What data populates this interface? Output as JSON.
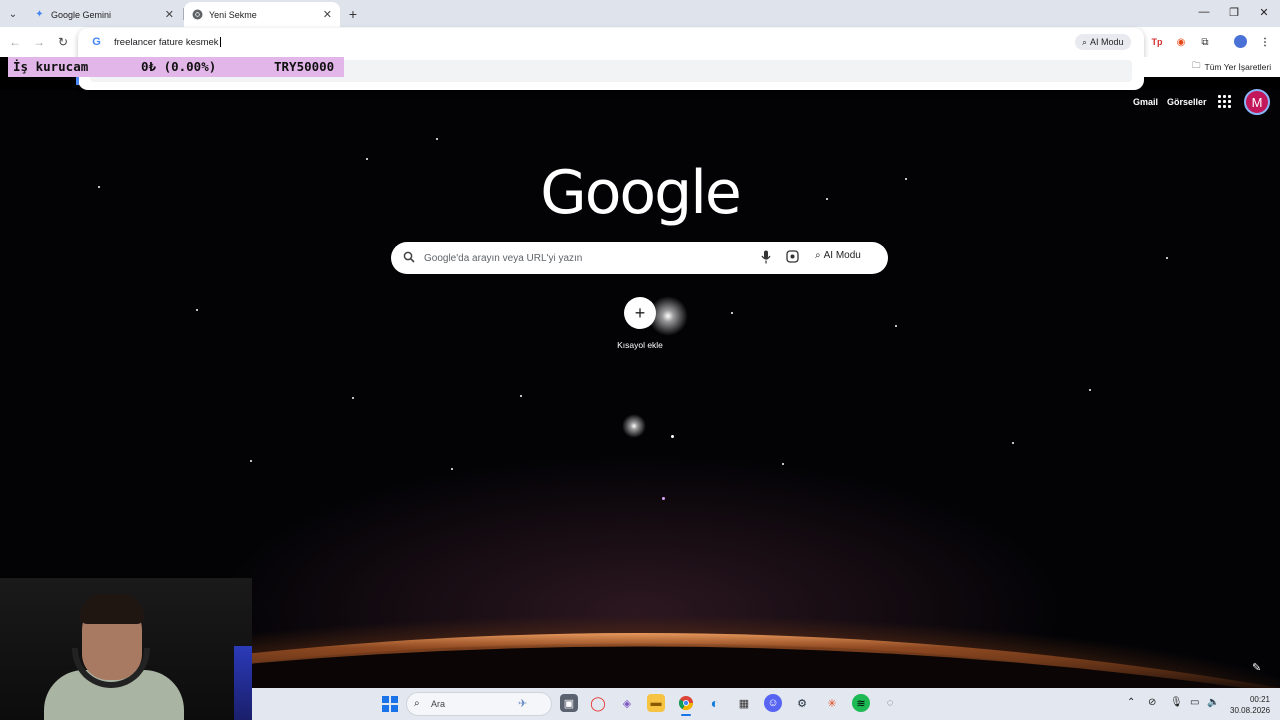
{
  "browser": {
    "tabs": [
      {
        "title": "Google Gemini",
        "active": false
      },
      {
        "title": "Yeni Sekme",
        "active": true
      }
    ],
    "omnibox": {
      "query": "freelancer fature kesmek",
      "ai_mode_label": "AI Modu"
    },
    "bookmarks": {
      "all_bookmarks_label": "Tüm Yer İşaretleri"
    }
  },
  "ticker": {
    "label": "İş kurucam",
    "change": "0₺ (0.00%)",
    "goal": "TRY50000"
  },
  "newtab": {
    "header_links": {
      "gmail": "Gmail",
      "images": "Görseller"
    },
    "avatar_letter": "M",
    "logo_text": "Google",
    "search_placeholder": "Google'da arayın veya URL'yi yazın",
    "ai_mode_label": "AI Modu",
    "shortcut_add_label": "Kısayol ekle"
  },
  "taskbar": {
    "search_label": "Ara",
    "clock_time": "00:21",
    "clock_date": "30.08.2026",
    "accent_color": "#1a73e8"
  },
  "icons": {
    "tab_search": "chevron-down-icon",
    "gemini": "gemini-sparkle-icon",
    "chrome": "chrome-icon",
    "new_tab": "plus-icon",
    "back": "arrow-left-icon",
    "forward": "arrow-right-icon",
    "reload": "reload-icon",
    "mic": "microphone-icon",
    "lens": "lens-icon",
    "apps": "apps-grid-icon",
    "pencil": "pencil-icon"
  }
}
